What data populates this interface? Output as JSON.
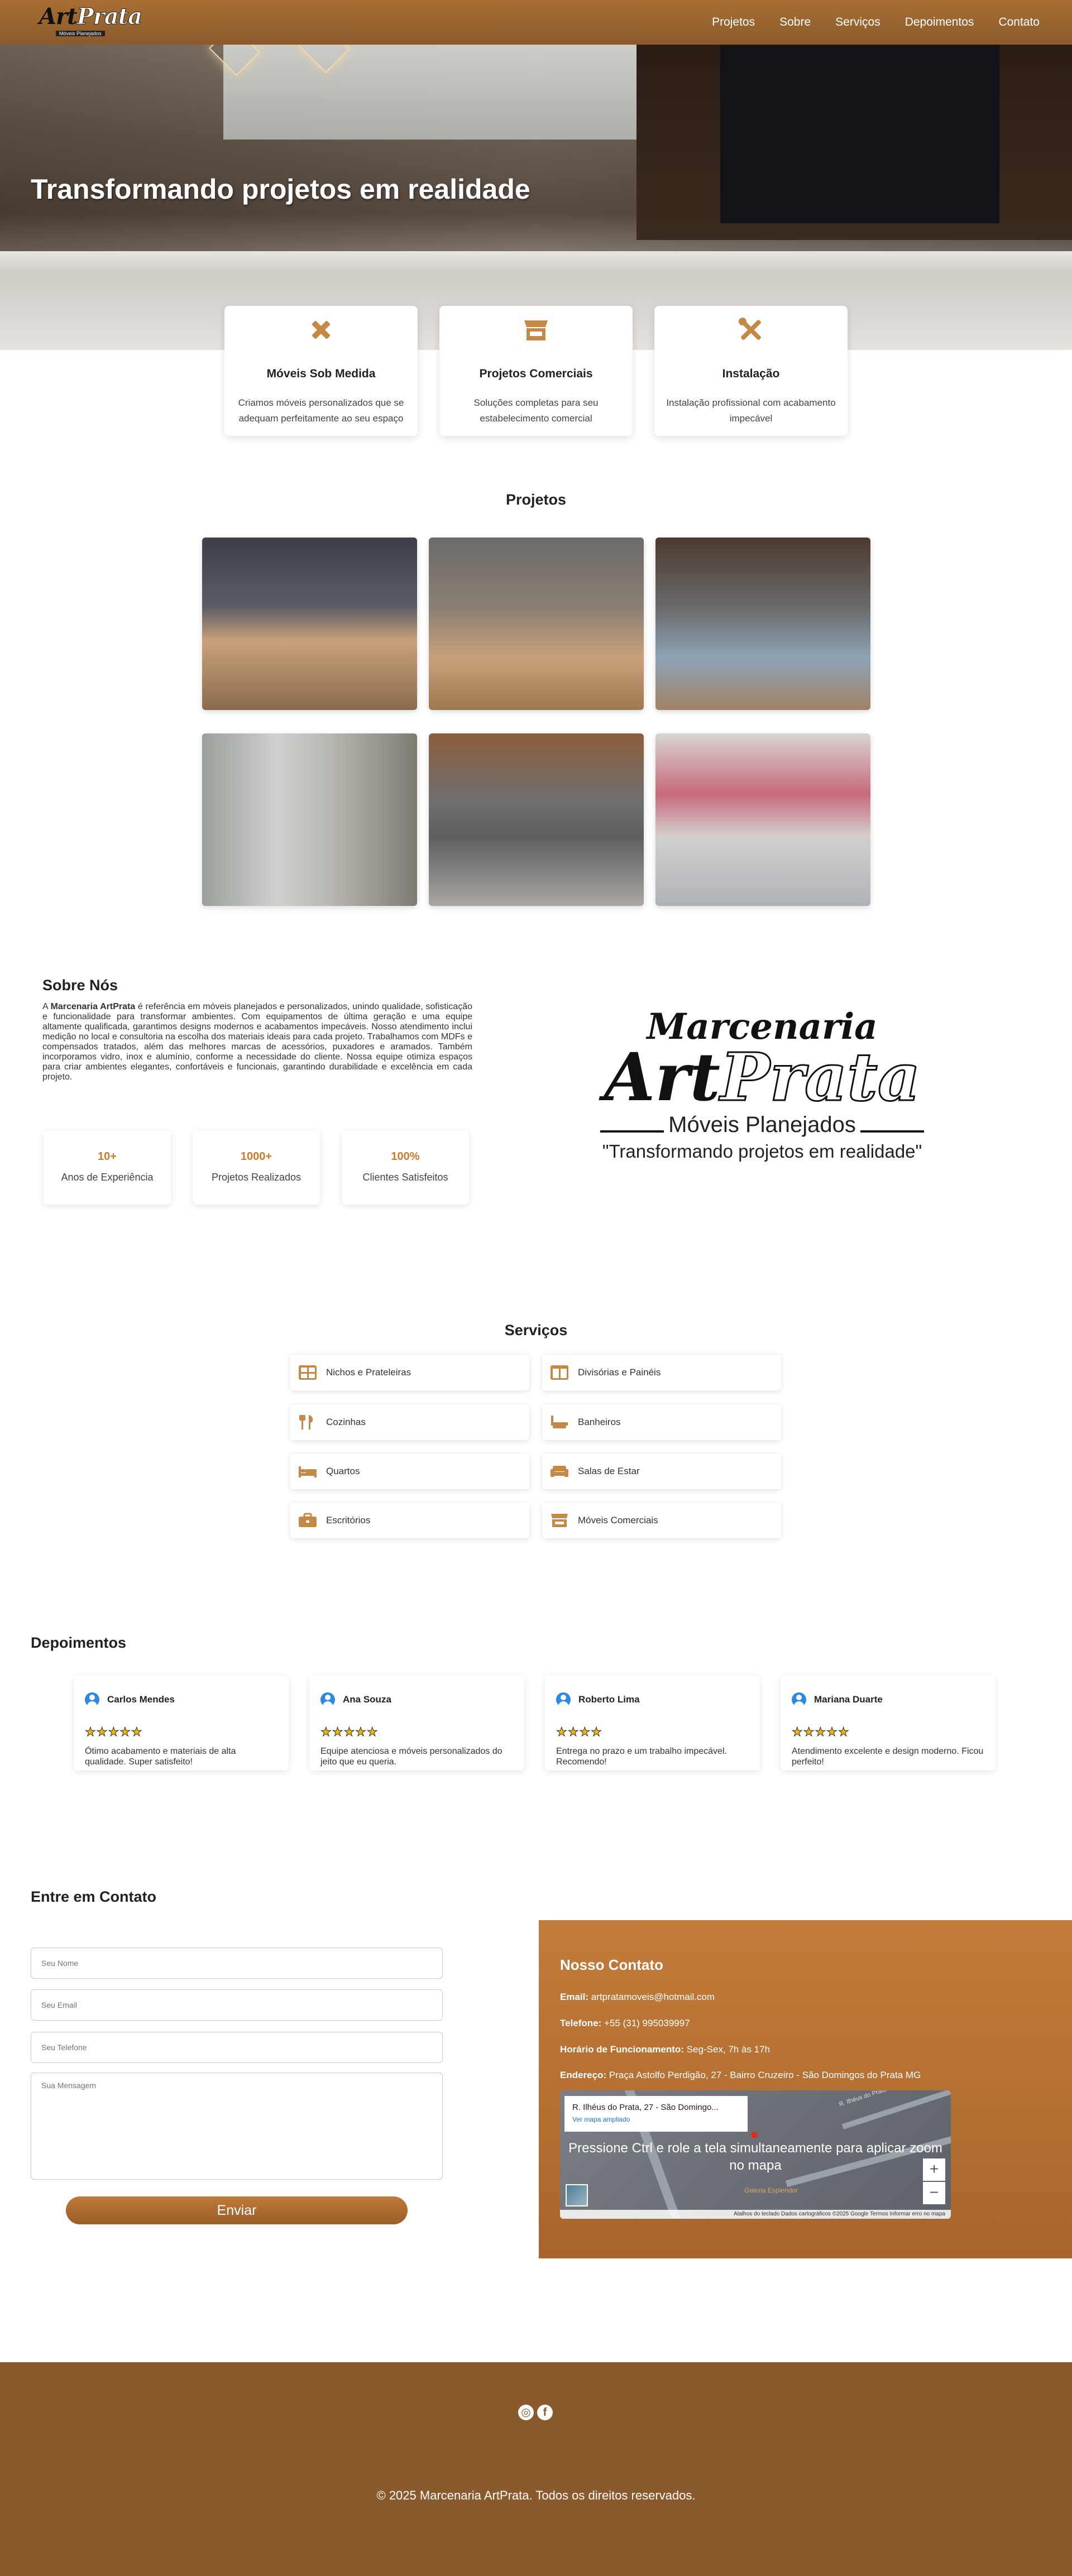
{
  "brand": {
    "logo_text_1": "Art",
    "logo_text_2": "Prata",
    "logo_tagline": "Móveis Planejados"
  },
  "nav": {
    "items": [
      "Projetos",
      "Sobre",
      "Serviços",
      "Depoimentos",
      "Contato"
    ]
  },
  "hero": {
    "title": "Transformando projetos em realidade"
  },
  "features": [
    {
      "icon": "pencil-ruler-icon",
      "title": "Móveis Sob Medida",
      "text": "Criamos móveis personalizados que se adequam perfeitamente ao seu espaço"
    },
    {
      "icon": "store-icon",
      "title": "Projetos Comerciais",
      "text": "Soluções completas para seu estabelecimento comercial"
    },
    {
      "icon": "tools-icon",
      "title": "Instalação",
      "text": "Instalação profissional com acabamento impecável"
    }
  ],
  "projects": {
    "title": "Projetos"
  },
  "about": {
    "title": "Sobre Nós",
    "brand_bold": "Marcenaria ArtPrata",
    "text_prefix": "A ",
    "text_body": " é referência em móveis planejados e personalizados, unindo qualidade, sofisticação e funcionalidade para transformar ambientes. Com equipamentos de última geração e uma equipe altamente qualificada, garantimos designs modernos e acabamentos impecáveis. Nosso atendimento inclui medição no local e consultoria na escolha dos materiais ideais para cada projeto. Trabalhamos com MDFs e compensados tratados, além das melhores marcas de acessórios, puxadores e aramados. Também incorporamos vidro, inox e alumínio, conforme a necessidade do cliente. Nossa equipe otimiza espaços para criar ambientes elegantes, confortáveis e funcionais, garantindo durabilidade e excelência em cada projeto.",
    "stats": [
      {
        "value": "10+",
        "label": "Anos de Experiência"
      },
      {
        "value": "1000+",
        "label": "Projetos Realizados"
      },
      {
        "value": "100%",
        "label": "Clientes Satisfeitos"
      }
    ],
    "logo": {
      "line1": "Marcenaria",
      "art": "Art",
      "prata": "Prata",
      "sub": "Móveis Planejados",
      "tagline": "\"Transformando projetos em realidade\""
    }
  },
  "services": {
    "title": "Serviços",
    "items": [
      {
        "icon": "grid-icon",
        "label": "Nichos e Prateleiras"
      },
      {
        "icon": "columns-icon",
        "label": "Divisórias e Painéis"
      },
      {
        "icon": "utensils-icon",
        "label": "Cozinhas"
      },
      {
        "icon": "bath-icon",
        "label": "Banheiros"
      },
      {
        "icon": "bed-icon",
        "label": "Quartos"
      },
      {
        "icon": "couch-icon",
        "label": "Salas de Estar"
      },
      {
        "icon": "briefcase-icon",
        "label": "Escritórios"
      },
      {
        "icon": "store-icon",
        "label": "Móveis Comerciais"
      }
    ]
  },
  "testimonials": {
    "title": "Depoimentos",
    "items": [
      {
        "name": "Carlos Mendes",
        "stars": "★★★★★",
        "text": "Ótimo acabamento e materiais de alta qualidade. Super satisfeito!"
      },
      {
        "name": "Ana Souza",
        "stars": "★★★★★",
        "text": "Equipe atenciosa e móveis personalizados do jeito que eu queria."
      },
      {
        "name": "Roberto Lima",
        "stars": "★★★★",
        "text": "Entrega no prazo e um trabalho impecável. Recomendo!"
      },
      {
        "name": "Mariana Duarte",
        "stars": "★★★★★",
        "text": "Atendimento excelente e design moderno. Ficou perfeito!"
      }
    ]
  },
  "contact": {
    "title": "Entre em Contato",
    "name_placeholder": "Seu Nome",
    "email_placeholder": "Seu Email",
    "phone_placeholder": "Seu Telefone",
    "message_placeholder": "Sua Mensagem",
    "submit": "Enviar",
    "info_title": "Nosso Contato",
    "email_label": "Email:",
    "email_value": "artpratamoveis@hotmail.com",
    "phone_label": "Telefone:",
    "phone_value": "+55 (31) 995039997",
    "hours_label": "Horário de Funcionamento:",
    "hours_value": "Seg-Sex, 7h às 17h",
    "address_label": "Endereço:",
    "address_value": "Praça Astolfo Perdigão, 27 - Bairro Cruzeiro - São Domingos do Prata MG",
    "map": {
      "popup_title": "R. Ilhéus do Prata, 27 - São Domingo...",
      "popup_link": "Ver mapa ampliado",
      "overlay": "Pressione Ctrl e role a tela simultaneamente para aplicar zoom no mapa",
      "place_label": "Galeria Esplendor",
      "street_label": "R. Ilhéus do Prata",
      "zoom_in": "+",
      "zoom_out": "−",
      "footer": "Atalhos do teclado   Dados cartográficos ©2025 Google   Termos   Informar erro no mapa"
    }
  },
  "footer": {
    "copyright": "© 2025 Marcenaria ArtPrata. Todos os direitos reservados.",
    "social": [
      "instagram-icon",
      "facebook-icon"
    ]
  },
  "colors": {
    "accent": "#c97d2b",
    "brown": "#8a592c",
    "icon": "#c48a45",
    "star": "#f2b705"
  }
}
